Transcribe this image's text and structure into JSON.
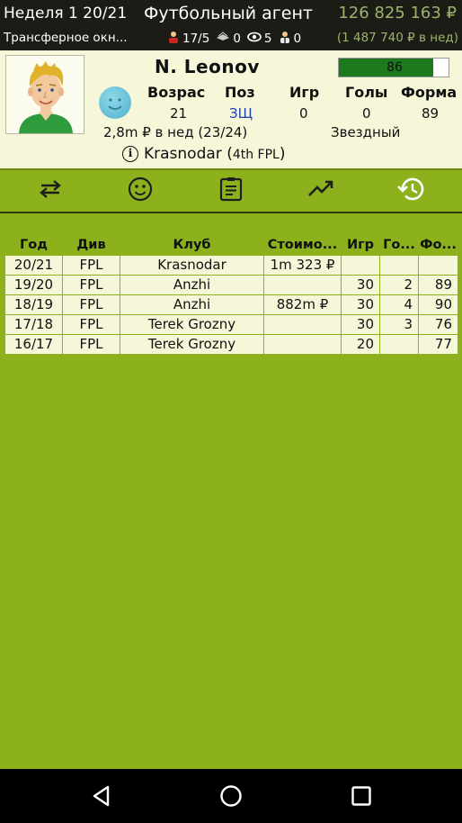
{
  "topbar": {
    "week": "Неделя 1 20/21",
    "title": "Футбольный агент",
    "money": "126 825 163 ₽",
    "transfer": "Трансферное окн...",
    "counters": {
      "players": "17/5",
      "offers": "0",
      "scouts": "5",
      "agents": "0"
    },
    "weekly": "(1 487 740 ₽ в нед)"
  },
  "player": {
    "name": "N. Leonov",
    "rating": "86",
    "rating_fraction": 0.86,
    "headers": {
      "age": "Возрас",
      "pos": "Поз",
      "games": "Игр",
      "goals": "Голы",
      "form": "Форма"
    },
    "values": {
      "age": "21",
      "pos": "ЗЩ",
      "games": "0",
      "goals": "0",
      "form": "89"
    },
    "salary": "2,8m ₽ в нед (23/24)",
    "status": "Звездный",
    "club": "Krasnodar (",
    "league": "4th FPL",
    "club_close": ")"
  },
  "tabs": [
    {
      "icon": "swap-arrows-icon"
    },
    {
      "icon": "smiley-icon"
    },
    {
      "icon": "clipboard-icon"
    },
    {
      "icon": "trending-up-icon"
    },
    {
      "icon": "history-icon",
      "active": true
    }
  ],
  "history": {
    "columns": [
      "Год",
      "Див",
      "Клуб",
      "Стоимо...",
      "Игр",
      "Го...",
      "Фо..."
    ],
    "rows": [
      [
        "20/21",
        "FPL",
        "Krasnodar",
        "1m 323 ₽",
        "",
        "",
        ""
      ],
      [
        "19/20",
        "FPL",
        "Anzhi",
        "",
        "30",
        "2",
        "89"
      ],
      [
        "18/19",
        "FPL",
        "Anzhi",
        "882m ₽",
        "30",
        "4",
        "90"
      ],
      [
        "17/18",
        "FPL",
        "Terek Grozny",
        "",
        "30",
        "3",
        "76"
      ],
      [
        "16/17",
        "FPL",
        "Terek Grozny",
        "",
        "20",
        "",
        "77"
      ]
    ]
  },
  "colors": {
    "accent_green": "#8cb11c",
    "card_bg": "#f6f6d8",
    "money_green": "#9bb36a",
    "rating_fill": "#1c7a1c",
    "position_blue": "#1e3fb0"
  }
}
